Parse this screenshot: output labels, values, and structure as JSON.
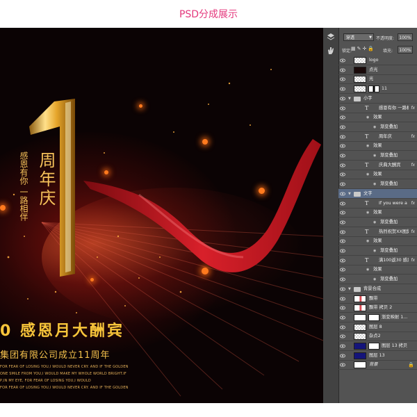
{
  "page_title": "PSD分成展示",
  "canvas": {
    "vertical_big": "周年庆",
    "vertical_small": "感恩有你 一路相伴",
    "headline": "0  感恩月大酬宾",
    "subline": "集团有限公司成立11周年",
    "english_lines": [
      "FOR FEAR OF LOSING YOU,I WOULD NEVER CRY.  AND IF THE GOLDEN",
      "ONE SMILE FROM YOU,I WOULD MAKE MY WHOLE WORLD BRIGHT.IF",
      "P,IN MY EYE,  FOR FEAR OF LOSING YOU,I WOULD",
      "FOR FEAR OF LOSING YOU,I WOULD NEVER CRY.  AND IF THE GOLDEN"
    ],
    "colors": {
      "gold": "#f7c43a",
      "red": "#c8161d",
      "background": "#0b0304"
    }
  },
  "panel": {
    "blend_mode": "穿透",
    "opacity_label": "不透明度:",
    "opacity_value": "100%",
    "lock_label": "锁定:",
    "fill_label": "填充:",
    "fill_value": "100%",
    "layers": [
      {
        "name": "logo",
        "kind": "layer",
        "thumb": "checker"
      },
      {
        "name": "点光",
        "kind": "layer",
        "thumb": "dark"
      },
      {
        "name": "光",
        "kind": "layer",
        "thumb": "checker"
      },
      {
        "name": "11",
        "kind": "masked",
        "thumb": "checker"
      },
      {
        "name": "小字",
        "kind": "group",
        "open": true
      },
      {
        "name": "感恩有你 一路相伴",
        "kind": "text",
        "fx": true
      },
      {
        "name": "效果",
        "kind": "effect"
      },
      {
        "name": "渐变叠加",
        "kind": "subeffect"
      },
      {
        "name": "周年庆",
        "kind": "text",
        "fx": true
      },
      {
        "name": "效果",
        "kind": "effect"
      },
      {
        "name": "渐变叠加",
        "kind": "subeffect"
      },
      {
        "name": "庆典大酬宾",
        "kind": "text",
        "fx": true
      },
      {
        "name": "效果",
        "kind": "effect"
      },
      {
        "name": "渐变叠加",
        "kind": "subeffect"
      },
      {
        "name": "文字",
        "kind": "group",
        "open": true,
        "selected": true
      },
      {
        "name": "If you were a tear...",
        "kind": "text",
        "fx": true
      },
      {
        "name": "效果",
        "kind": "effect"
      },
      {
        "name": "渐变叠加",
        "kind": "subeffect"
      },
      {
        "name": "热烈祝贺XX图集...",
        "kind": "text",
        "fx": true
      },
      {
        "name": "效果",
        "kind": "effect"
      },
      {
        "name": "渐变叠加",
        "kind": "subeffect"
      },
      {
        "name": "满100返30 感恩...",
        "kind": "text",
        "fx": true
      },
      {
        "name": "效果",
        "kind": "effect"
      },
      {
        "name": "渐变叠加",
        "kind": "subeffect"
      },
      {
        "name": "背景合成",
        "kind": "group",
        "open": true
      },
      {
        "name": "飘带",
        "kind": "layer",
        "thumb": "ribbon"
      },
      {
        "name": "飘带 拷贝 2",
        "kind": "layer",
        "thumb": "ribbon"
      },
      {
        "name": "渐变映射 1...",
        "kind": "adjust",
        "thumb": "white"
      },
      {
        "name": "图层 8",
        "kind": "layer",
        "thumb": "checker"
      },
      {
        "name": "杂点2",
        "kind": "layer",
        "thumb": "checker"
      },
      {
        "name": "图层 13 拷贝",
        "kind": "masked2",
        "thumb": "blue"
      },
      {
        "name": "图层 13",
        "kind": "layer",
        "thumb": "blue"
      },
      {
        "name": "背景",
        "kind": "background",
        "thumb": "white"
      }
    ]
  }
}
